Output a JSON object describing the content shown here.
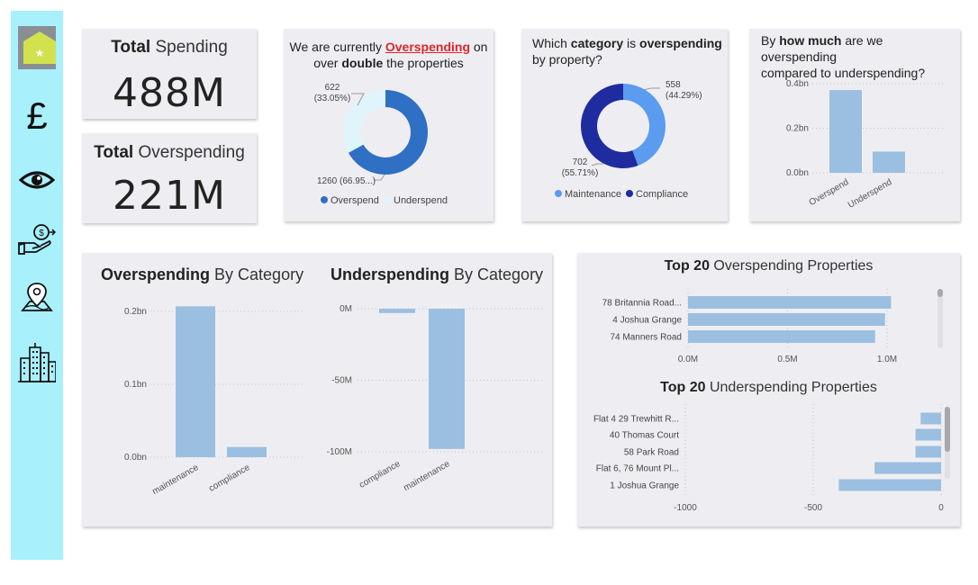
{
  "nav": {
    "items": [
      {
        "icon": "home-icon",
        "active": true
      },
      {
        "icon": "pound-icon"
      },
      {
        "icon": "eye-icon"
      },
      {
        "icon": "hand-money-icon"
      },
      {
        "icon": "map-pin-icon"
      },
      {
        "icon": "city-buildings-icon"
      }
    ]
  },
  "kpi": {
    "total_spending": {
      "title_bold": "Total",
      "title_rest": " Spending",
      "value": "488M"
    },
    "total_overspending": {
      "title_bold": "Total",
      "title_rest": " Overspending",
      "value": "221M"
    }
  },
  "donut1": {
    "t1": "We are currently ",
    "t_red": "Overspending",
    "t2": " on",
    "t3": "over ",
    "t_bold": "double",
    "t4": " the properties"
  },
  "donut2": {
    "t1": "Which ",
    "t_bold1": "category",
    "t2": " is ",
    "t_bold2": "overspending",
    "t3": "by property?"
  },
  "bar1": {
    "t1": "By ",
    "t_bold": "how much",
    "t2": " are we overspending",
    "t3": "compared to underspending?"
  },
  "cat_over": {
    "bold": "Overspending",
    "rest": " By Category"
  },
  "cat_under": {
    "bold": "Underspending",
    "rest": " By Category"
  },
  "top_over": {
    "bold": "Top 20",
    "rest": " Overspending Properties"
  },
  "top_under": {
    "bold": "Top 20",
    "rest": " Underspending Properties"
  },
  "colors": {
    "dark_blue": "#2f6fc4",
    "light_cyan": "#dff5fb",
    "mid_blue": "#5b9bf0",
    "navy": "#1e2ca0",
    "bar_blue": "#9bbfe0",
    "sidebar": "#a8f0fc",
    "home_tile": "#d2e24e",
    "red": "#e0242b"
  },
  "chart_data": [
    {
      "type": "pie",
      "subtype": "donut",
      "labels": [
        "Overspend",
        "Underspend"
      ],
      "values": [
        1260,
        622
      ],
      "data_labels": [
        "1260 (66.95...)",
        "622\n(33.05%)"
      ],
      "colors": [
        "#2f6fc4",
        "#dff5fb"
      ],
      "legend": "bottom"
    },
    {
      "type": "pie",
      "subtype": "donut",
      "labels": [
        "Maintenance",
        "Compliance"
      ],
      "values": [
        558,
        702
      ],
      "data_labels": [
        "558\n(44.29%)",
        "702\n(55.71%)"
      ],
      "colors": [
        "#5b9bf0",
        "#1e2ca0"
      ],
      "legend": "bottom"
    },
    {
      "type": "bar",
      "categories": [
        "Overspend",
        "Underspend"
      ],
      "values": [
        0.39,
        0.1
      ],
      "y_ticks": [
        "0.4bn",
        "0.2bn",
        "0.0bn"
      ],
      "ylim": [
        0,
        0.42
      ],
      "grid": true
    },
    {
      "type": "bar",
      "categories": [
        "maintenance",
        "compliance"
      ],
      "values": [
        0.207,
        0.014
      ],
      "y_ticks": [
        "0.2bn",
        "0.1bn",
        "0.0bn"
      ],
      "ylim": [
        0,
        0.2
      ],
      "grid": true
    },
    {
      "type": "bar",
      "categories": [
        "compliance",
        "maintenance"
      ],
      "values": [
        -3,
        -98
      ],
      "y_ticks": [
        "0M",
        "-50M",
        "-100M"
      ],
      "ylim": [
        -100,
        0
      ],
      "grid": true
    },
    {
      "type": "bar",
      "orientation": "horizontal",
      "categories": [
        "78 Britannia Road...",
        "4 Joshua Grange",
        "74 Manners Road"
      ],
      "values": [
        1.02,
        0.99,
        0.94
      ],
      "x_ticks": [
        "0.0M",
        "0.5M",
        "1.0M"
      ],
      "xlim": [
        0,
        1.0
      ]
    },
    {
      "type": "bar",
      "orientation": "horizontal",
      "categories": [
        "Flat 4 29 Trewhitt R...",
        "40 Thomas Court",
        "58 Park Road",
        "Flat 6, 76 Mount Pl...",
        "1 Joshua Grange"
      ],
      "values": [
        -80,
        -100,
        -100,
        -260,
        -400
      ],
      "x_ticks": [
        "-1000",
        "-500",
        "0"
      ],
      "xlim": [
        -1000,
        0
      ]
    }
  ]
}
